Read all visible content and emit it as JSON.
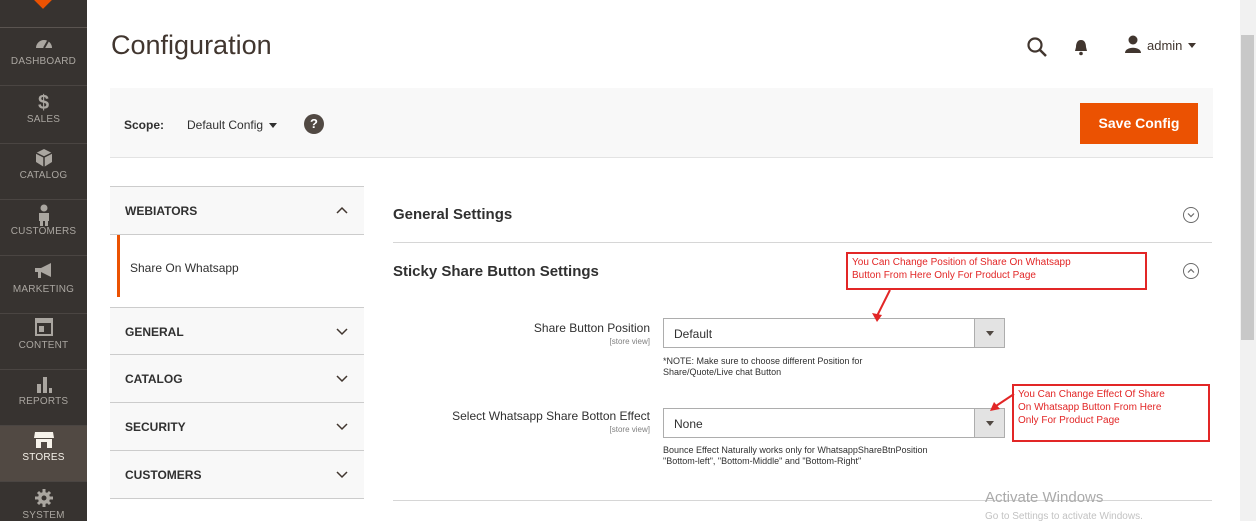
{
  "nav": {
    "items": [
      {
        "label": "DASHBOARD",
        "icon": "dashboard-icon"
      },
      {
        "label": "SALES",
        "icon": "dollar-icon"
      },
      {
        "label": "CATALOG",
        "icon": "box-icon"
      },
      {
        "label": "CUSTOMERS",
        "icon": "person-icon"
      },
      {
        "label": "MARKETING",
        "icon": "megaphone-icon"
      },
      {
        "label": "CONTENT",
        "icon": "layout-icon"
      },
      {
        "label": "REPORTS",
        "icon": "bar-chart-icon"
      },
      {
        "label": "STORES",
        "icon": "store-icon"
      },
      {
        "label": "SYSTEM",
        "icon": "gear-icon"
      }
    ],
    "active": "STORES"
  },
  "header": {
    "title": "Configuration",
    "user": "admin"
  },
  "scope": {
    "label": "Scope:",
    "value": "Default Config",
    "help": "?",
    "save_label": "Save Config"
  },
  "tabs": {
    "webiators": "WEBIATORS",
    "sub_item": "Share On Whatsapp",
    "groups": [
      "GENERAL",
      "CATALOG",
      "SECURITY",
      "CUSTOMERS"
    ]
  },
  "sections": {
    "general": "General Settings",
    "sticky": "Sticky Share Button Settings"
  },
  "fields": {
    "position": {
      "label": "Share Button Position",
      "scope": "[store view]",
      "value": "Default",
      "note1": "*NOTE: Make sure to choose different Position for",
      "note2": "Share/Quote/Live chat Button"
    },
    "effect": {
      "label": "Select Whatsapp Share Botton Effect",
      "scope": "[store view]",
      "value": "None",
      "note1": "Bounce Effect Naturally works only for WhatsappShareBtnPosition",
      "note2": "\"Bottom-left\", \"Bottom-Middle\" and \"Bottom-Right\""
    }
  },
  "annotations": {
    "a1_line1": "You Can Change Position of Share On Whatsapp",
    "a1_line2": "Button From Here Only For Product Page",
    "a2_line1": "You Can Change Effect Of Share",
    "a2_line2": "On Whatsapp Button From Here",
    "a2_line3": "Only For Product Page"
  },
  "watermark": {
    "line1": "Activate Windows",
    "line2": "Go to Settings to activate Windows."
  },
  "colors": {
    "accent": "#eb5202",
    "nav_bg": "#373330",
    "annotation": "#e22626"
  }
}
